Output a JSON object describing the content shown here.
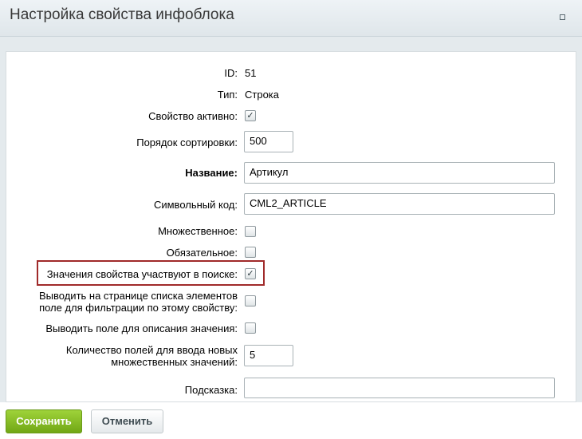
{
  "dialog": {
    "title": "Настройка свойства инфоблока"
  },
  "fields": {
    "id": {
      "label": "ID:",
      "value": "51"
    },
    "type": {
      "label": "Тип:",
      "value": "Строка"
    },
    "active": {
      "label": "Свойство активно:",
      "checked": true
    },
    "sort": {
      "label": "Порядок сортировки:",
      "value": "500"
    },
    "name": {
      "label": "Название:",
      "value": "Артикул"
    },
    "code": {
      "label": "Символьный код:",
      "value": "CML2_ARTICLE"
    },
    "multiple": {
      "label": "Множественное:",
      "checked": false
    },
    "required": {
      "label": "Обязательное:",
      "checked": false
    },
    "searchable": {
      "label": "Значения свойства участвуют в поиске:",
      "checked": true
    },
    "filtrable": {
      "label_line1": "Выводить на странице списка элементов",
      "label_line2": "поле для фильтрации по этому свойству:",
      "checked": false
    },
    "with_description": {
      "label": "Выводить поле для описания значения:",
      "checked": false
    },
    "multiple_count": {
      "label_line1": "Количество полей для ввода новых",
      "label_line2": "множественных значений:",
      "value": "5"
    },
    "hint": {
      "label": "Подсказка:",
      "value": ""
    }
  },
  "buttons": {
    "save": "Сохранить",
    "cancel": "Отменить"
  },
  "icons": {
    "checkmark": "✓",
    "expand": "expand-icon"
  },
  "colors": {
    "save_button": "#7cb51e",
    "highlight_border": "#a02a2a",
    "header_bg": "#e4eaed"
  }
}
